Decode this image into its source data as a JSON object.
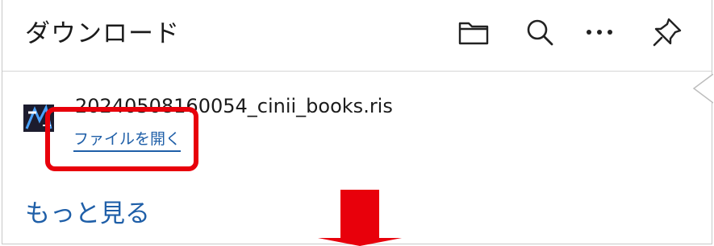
{
  "header": {
    "title": "ダウンロード",
    "icons": [
      "folder-icon",
      "search-icon",
      "more-options-icon",
      "pin-icon"
    ]
  },
  "download_item": {
    "file_name": "20240508160054_cinii_books.ris",
    "open_file_label": "ファイルを開く"
  },
  "footer": {
    "see_more_label": "もっと見る"
  },
  "colors": {
    "highlight": "#e8000b",
    "link": "#1f5fa8",
    "arrow": "#e8000b"
  }
}
